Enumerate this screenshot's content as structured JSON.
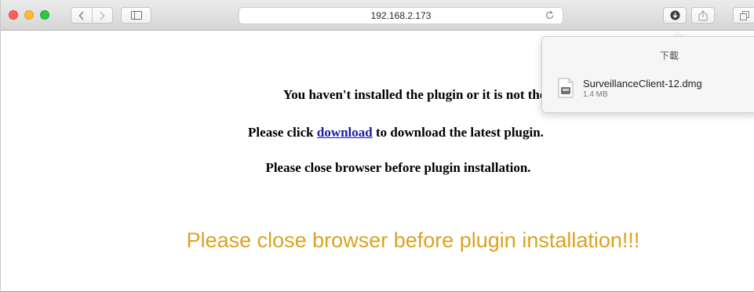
{
  "browser": {
    "url": "192.168.2.173"
  },
  "page": {
    "line1": "You haven't installed the plugin or it is not the late",
    "line2_before": "Please click ",
    "line2_link": "download",
    "line2_after": " to download the latest plugin.",
    "line3": "Please close browser before plugin installation.",
    "warning": "Please close browser before plugin installation!!!",
    "warning_color": "#dca220",
    "link_color": "#1a1aa6"
  },
  "downloads": {
    "title": "下載",
    "items": [
      {
        "name": "SurveillanceClient-12.dmg",
        "size": "1.4 MB"
      }
    ]
  },
  "icons": {
    "back": "chevron-left-icon",
    "forward": "chevron-right-icon",
    "sidebar": "sidebar-icon",
    "reload": "reload-icon",
    "download": "download-icon",
    "share": "share-icon",
    "tabs": "tabs-icon",
    "file": "dmg-file-icon"
  }
}
